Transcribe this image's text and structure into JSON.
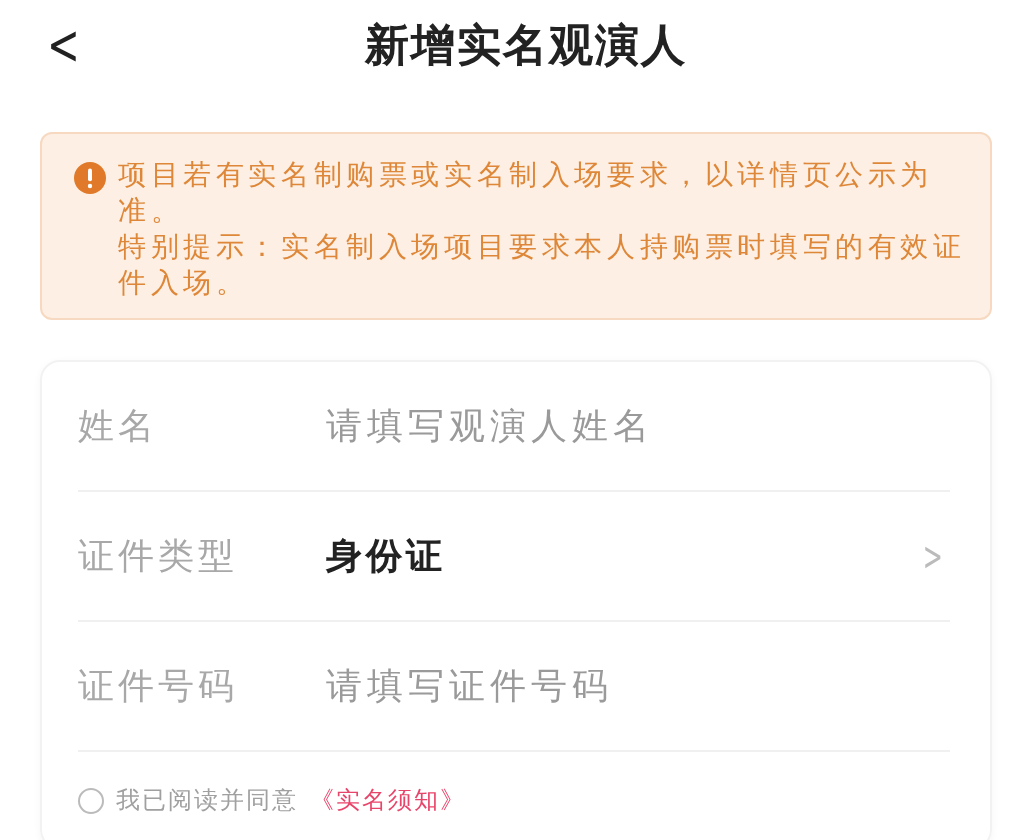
{
  "header": {
    "back": "<",
    "title": "新增实名观演人"
  },
  "notice": {
    "lines": [
      "项目若有实名制购票或实名制入场要求，以详情页公示为准。",
      "特别提示：实名制入场项目要求本人持购票时填写的有效证件入场。"
    ]
  },
  "form": {
    "rows": [
      {
        "kind": "input",
        "label": "姓名",
        "placeholder": "请填写观演人姓名"
      },
      {
        "kind": "select",
        "label": "证件类型",
        "value": "身份证",
        "arrow": ">"
      },
      {
        "kind": "input",
        "label": "证件号码",
        "placeholder": "请填写证件号码"
      }
    ],
    "agreement": {
      "checked": false,
      "text": "我已阅读并同意",
      "link": "《实名须知》"
    }
  }
}
